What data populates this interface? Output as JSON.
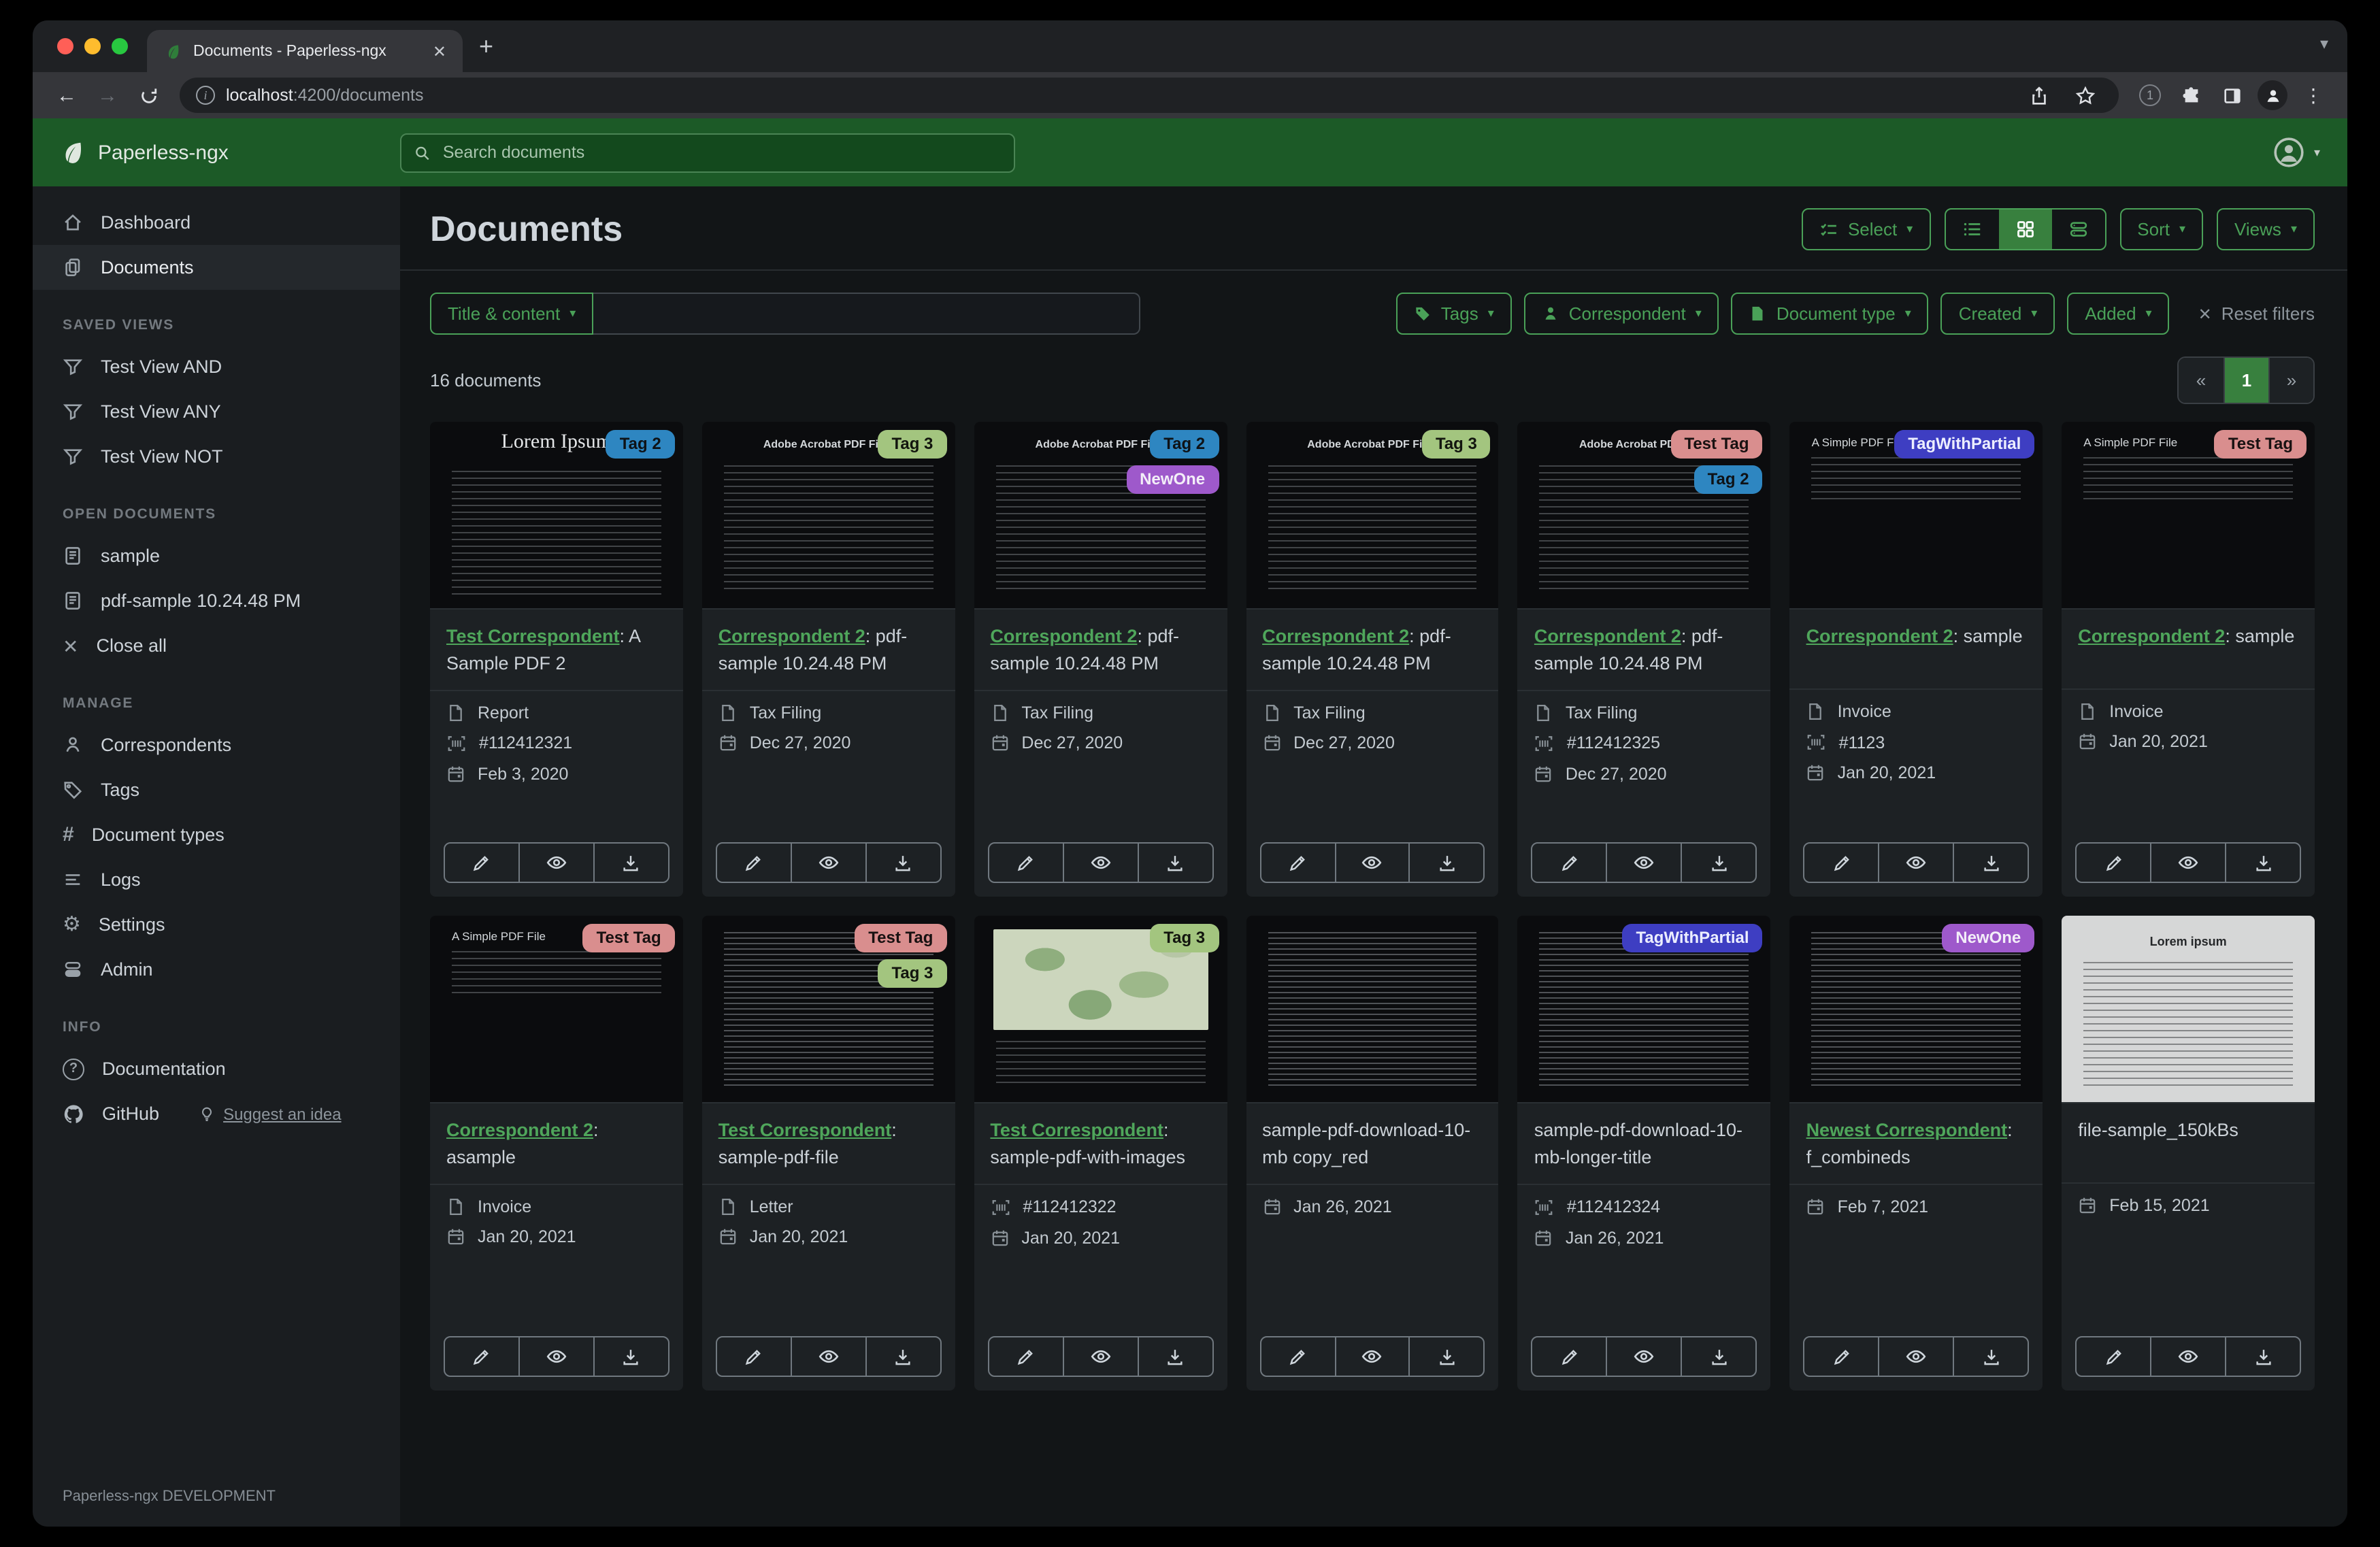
{
  "browser": {
    "tab_title": "Documents - Paperless-ngx",
    "url_host": "localhost",
    "url_rest": ":4200/documents",
    "badge_count": "1"
  },
  "header": {
    "brand": "Paperless-ngx",
    "search_placeholder": "Search documents"
  },
  "sidebar": {
    "main": [
      {
        "label": "Dashboard"
      },
      {
        "label": "Documents"
      }
    ],
    "saved_views": {
      "heading": "SAVED VIEWS",
      "items": [
        {
          "label": "Test View AND"
        },
        {
          "label": "Test View ANY"
        },
        {
          "label": "Test View NOT"
        }
      ]
    },
    "open_documents": {
      "heading": "OPEN DOCUMENTS",
      "items": [
        {
          "label": "sample"
        },
        {
          "label": "pdf-sample 10.24.48 PM"
        }
      ],
      "close_label": "Close all"
    },
    "manage": {
      "heading": "MANAGE",
      "items": [
        {
          "label": "Correspondents"
        },
        {
          "label": "Tags"
        },
        {
          "label": "Document types"
        },
        {
          "label": "Logs"
        },
        {
          "label": "Settings"
        },
        {
          "label": "Admin"
        }
      ]
    },
    "info": {
      "heading": "INFO",
      "docs_label": "Documentation",
      "github_label": "GitHub",
      "suggest_label": "Suggest an idea"
    },
    "footer": "Paperless-ngx DEVELOPMENT"
  },
  "content": {
    "title": "Documents",
    "toolbar": {
      "select_label": "Select",
      "sort_label": "Sort",
      "views_label": "Views"
    },
    "filters": {
      "field_label": "Title & content",
      "chips": [
        {
          "label": "Tags",
          "icon": "tag"
        },
        {
          "label": "Correspondent",
          "icon": "person"
        },
        {
          "label": "Document type",
          "icon": "file"
        },
        {
          "label": "Created",
          "icon": ""
        },
        {
          "label": "Added",
          "icon": ""
        }
      ],
      "reset_label": "Reset filters"
    },
    "count": "16 documents",
    "pagination": {
      "prev": "«",
      "page": "1",
      "next": "»"
    }
  },
  "cards": [
    {
      "tags": [
        {
          "label": "Tag 2",
          "bg": "#2e86c1",
          "fg": "#0e1216"
        }
      ],
      "thumb": {
        "variant": "serif",
        "title": "Lorem Ipsum"
      },
      "correspondent": "Test Correspondent",
      "title_rest": ": A Sample PDF 2",
      "meta": [
        {
          "icon": "file",
          "text": "Report"
        },
        {
          "icon": "asn",
          "text": "#112412321"
        },
        {
          "icon": "calendar",
          "text": "Feb 3, 2020"
        }
      ]
    },
    {
      "tags": [
        {
          "label": "Tag 3",
          "bg": "#a3c57f",
          "fg": "#12150e"
        }
      ],
      "thumb": {
        "variant": "acrobat",
        "title": "Adobe Acrobat PDF Files"
      },
      "correspondent": "Correspondent 2",
      "title_rest": ": pdf-sample 10.24.48 PM",
      "meta": [
        {
          "icon": "file",
          "text": "Tax Filing"
        },
        {
          "icon": "calendar",
          "text": "Dec 27, 2020"
        }
      ]
    },
    {
      "tags": [
        {
          "label": "Tag 2",
          "bg": "#2e86c1",
          "fg": "#0e1216"
        },
        {
          "label": "NewOne",
          "bg": "#9e59cb",
          "fg": "#f3eef8"
        }
      ],
      "thumb": {
        "variant": "acrobat",
        "title": "Adobe Acrobat PDF Files"
      },
      "correspondent": "Correspondent 2",
      "title_rest": ": pdf-sample 10.24.48 PM",
      "meta": [
        {
          "icon": "file",
          "text": "Tax Filing"
        },
        {
          "icon": "calendar",
          "text": "Dec 27, 2020"
        }
      ]
    },
    {
      "tags": [
        {
          "label": "Tag 3",
          "bg": "#a3c57f",
          "fg": "#12150e"
        }
      ],
      "thumb": {
        "variant": "acrobat",
        "title": "Adobe Acrobat PDF Files"
      },
      "correspondent": "Correspondent 2",
      "title_rest": ": pdf-sample 10.24.48 PM",
      "meta": [
        {
          "icon": "file",
          "text": "Tax Filing"
        },
        {
          "icon": "calendar",
          "text": "Dec 27, 2020"
        }
      ]
    },
    {
      "tags": [
        {
          "label": "Test Tag",
          "bg": "#d98e8e",
          "fg": "#181111"
        },
        {
          "label": "Tag 2",
          "bg": "#2e86c1",
          "fg": "#0e1216"
        }
      ],
      "thumb": {
        "variant": "acrobat",
        "title": "Adobe Acrobat PDF Files"
      },
      "correspondent": "Correspondent 2",
      "title_rest": ": pdf-sample 10.24.48 PM",
      "meta": [
        {
          "icon": "file",
          "text": "Tax Filing"
        },
        {
          "icon": "asn",
          "text": "#112412325"
        },
        {
          "icon": "calendar",
          "text": "Dec 27, 2020"
        }
      ]
    },
    {
      "tags": [
        {
          "label": "TagWithPartial",
          "bg": "#3e3ec2",
          "fg": "#eceeff"
        }
      ],
      "thumb": {
        "variant": "simple",
        "title": "A Simple PDF File"
      },
      "correspondent": "Correspondent 2",
      "title_rest": ": sample",
      "meta": [
        {
          "icon": "file",
          "text": "Invoice"
        },
        {
          "icon": "asn",
          "text": "#1123"
        },
        {
          "icon": "calendar",
          "text": "Jan 20, 2021"
        }
      ]
    },
    {
      "tags": [
        {
          "label": "Test Tag",
          "bg": "#d98e8e",
          "fg": "#181111"
        }
      ],
      "thumb": {
        "variant": "simple",
        "title": "A Simple PDF File"
      },
      "correspondent": "Correspondent 2",
      "title_rest": ": sample",
      "meta": [
        {
          "icon": "file",
          "text": "Invoice"
        },
        {
          "icon": "calendar",
          "text": "Jan 20, 2021"
        }
      ]
    },
    {
      "tags": [
        {
          "label": "Test Tag",
          "bg": "#d98e8e",
          "fg": "#181111"
        }
      ],
      "thumb": {
        "variant": "simple",
        "title": "A Simple PDF File"
      },
      "correspondent": "Correspondent 2",
      "title_rest": ": asample",
      "meta": [
        {
          "icon": "file",
          "text": "Invoice"
        },
        {
          "icon": "calendar",
          "text": "Jan 20, 2021"
        }
      ]
    },
    {
      "tags": [
        {
          "label": "Test Tag",
          "bg": "#d98e8e",
          "fg": "#181111"
        },
        {
          "label": "Tag 3",
          "bg": "#a3c57f",
          "fg": "#12150e"
        }
      ],
      "thumb": {
        "variant": "dense",
        "title": ""
      },
      "correspondent": "Test Correspondent",
      "title_rest": ": sample-pdf-file",
      "meta": [
        {
          "icon": "file",
          "text": "Letter"
        },
        {
          "icon": "calendar",
          "text": "Jan 20, 2021"
        }
      ]
    },
    {
      "tags": [
        {
          "label": "Tag 3",
          "bg": "#a3c57f",
          "fg": "#12150e"
        }
      ],
      "thumb": {
        "variant": "map",
        "title": ""
      },
      "correspondent": "Test Correspondent",
      "title_rest": ": sample-pdf-with-images",
      "meta": [
        {
          "icon": "asn",
          "text": "#112412322"
        },
        {
          "icon": "calendar",
          "text": "Jan 20, 2021"
        }
      ]
    },
    {
      "tags": [],
      "thumb": {
        "variant": "dense",
        "title": ""
      },
      "correspondent": "",
      "title_rest": "sample-pdf-download-10-mb copy_red",
      "meta": [
        {
          "icon": "calendar",
          "text": "Jan 26, 2021"
        }
      ]
    },
    {
      "tags": [
        {
          "label": "TagWithPartial",
          "bg": "#3e3ec2",
          "fg": "#eceeff"
        }
      ],
      "thumb": {
        "variant": "dense",
        "title": ""
      },
      "correspondent": "",
      "title_rest": "sample-pdf-download-10-mb-longer-title",
      "meta": [
        {
          "icon": "asn",
          "text": "#112412324"
        },
        {
          "icon": "calendar",
          "text": "Jan 26, 2021"
        }
      ]
    },
    {
      "tags": [
        {
          "label": "NewOne",
          "bg": "#9e59cb",
          "fg": "#f3eef8"
        }
      ],
      "thumb": {
        "variant": "dense",
        "title": ""
      },
      "correspondent": "Newest Correspondent",
      "title_rest": ": f_combineds",
      "meta": [
        {
          "icon": "calendar",
          "text": "Feb 7, 2021"
        }
      ]
    },
    {
      "tags": [],
      "thumb": {
        "variant": "light",
        "title": "Lorem ipsum"
      },
      "correspondent": "",
      "title_rest": "file-sample_150kBs",
      "meta": [
        {
          "icon": "calendar",
          "text": "Feb 15, 2021"
        }
      ]
    }
  ]
}
